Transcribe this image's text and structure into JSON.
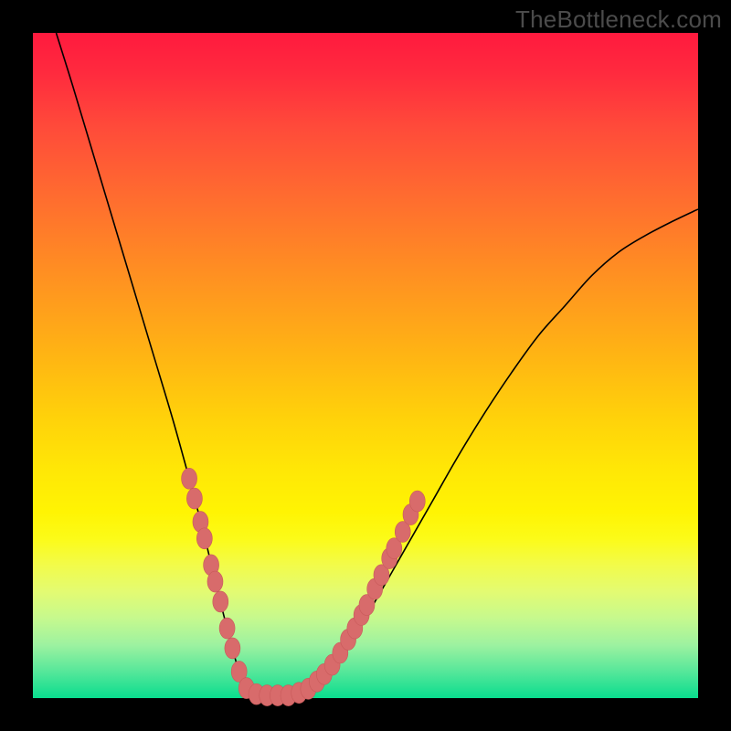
{
  "watermark": "TheBottleneck.com",
  "colors": {
    "frame": "#000000",
    "curve": "#000000",
    "marker": "#d86b6b",
    "marker_stroke": "#c85a5a"
  },
  "chart_data": {
    "type": "line",
    "title": "",
    "xlabel": "",
    "ylabel": "",
    "xlim": [
      0,
      1
    ],
    "ylim": [
      0,
      1
    ],
    "grid": false,
    "legend": false,
    "series": [
      {
        "name": "curve",
        "x": [
          0.035,
          0.06,
          0.09,
          0.12,
          0.15,
          0.18,
          0.21,
          0.235,
          0.255,
          0.272,
          0.285,
          0.3,
          0.312,
          0.33,
          0.355,
          0.385,
          0.415,
          0.445,
          0.48,
          0.52,
          0.56,
          0.6,
          0.64,
          0.68,
          0.72,
          0.76,
          0.8,
          0.84,
          0.88,
          0.92,
          0.96,
          1.0
        ],
        "y": [
          1.0,
          0.92,
          0.82,
          0.72,
          0.62,
          0.52,
          0.42,
          0.33,
          0.255,
          0.185,
          0.132,
          0.075,
          0.035,
          0.012,
          0.004,
          0.004,
          0.014,
          0.04,
          0.088,
          0.155,
          0.225,
          0.295,
          0.365,
          0.43,
          0.49,
          0.545,
          0.59,
          0.635,
          0.67,
          0.695,
          0.716,
          0.735
        ]
      }
    ],
    "markers": [
      {
        "x": 0.235,
        "y": 0.33
      },
      {
        "x": 0.243,
        "y": 0.3
      },
      {
        "x": 0.252,
        "y": 0.265
      },
      {
        "x": 0.258,
        "y": 0.24
      },
      {
        "x": 0.268,
        "y": 0.2
      },
      {
        "x": 0.274,
        "y": 0.175
      },
      {
        "x": 0.282,
        "y": 0.145
      },
      {
        "x": 0.292,
        "y": 0.105
      },
      {
        "x": 0.3,
        "y": 0.075
      },
      {
        "x": 0.31,
        "y": 0.04
      },
      {
        "x": 0.321,
        "y": 0.015
      },
      {
        "x": 0.336,
        "y": 0.006
      },
      {
        "x": 0.352,
        "y": 0.004
      },
      {
        "x": 0.368,
        "y": 0.004
      },
      {
        "x": 0.384,
        "y": 0.004
      },
      {
        "x": 0.4,
        "y": 0.008
      },
      {
        "x": 0.414,
        "y": 0.014
      },
      {
        "x": 0.427,
        "y": 0.025
      },
      {
        "x": 0.438,
        "y": 0.036
      },
      {
        "x": 0.45,
        "y": 0.05
      },
      {
        "x": 0.462,
        "y": 0.068
      },
      {
        "x": 0.474,
        "y": 0.088
      },
      {
        "x": 0.484,
        "y": 0.105
      },
      {
        "x": 0.494,
        "y": 0.125
      },
      {
        "x": 0.502,
        "y": 0.14
      },
      {
        "x": 0.514,
        "y": 0.164
      },
      {
        "x": 0.524,
        "y": 0.185
      },
      {
        "x": 0.536,
        "y": 0.21
      },
      {
        "x": 0.543,
        "y": 0.225
      },
      {
        "x": 0.556,
        "y": 0.25
      },
      {
        "x": 0.568,
        "y": 0.276
      },
      {
        "x": 0.578,
        "y": 0.296
      }
    ]
  }
}
